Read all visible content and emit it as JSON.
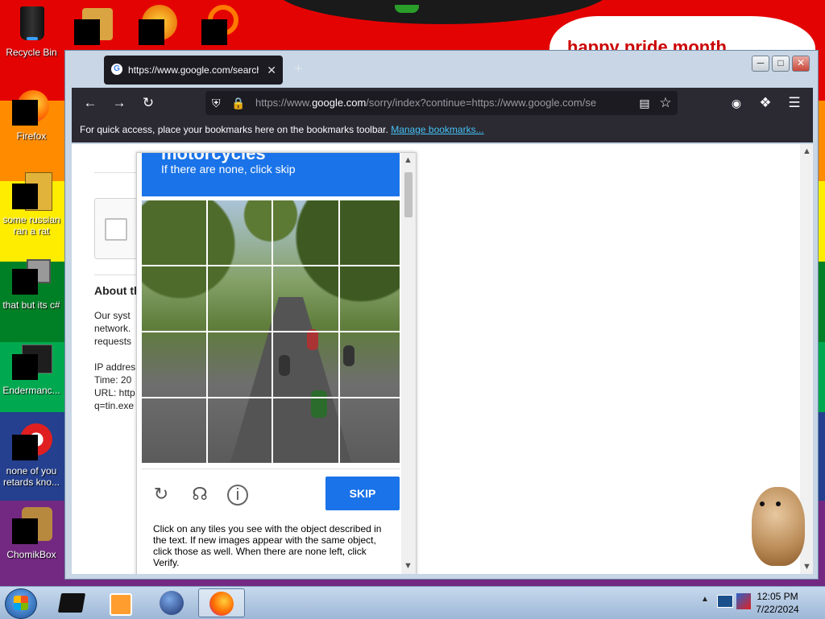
{
  "wallpaper": {
    "stripes": [
      "#e40303",
      "#ff8c00",
      "#ffed00",
      "#008026",
      "#24408e",
      "#732982"
    ],
    "banner_text": "happy pride month"
  },
  "desktop_icons": [
    {
      "label": "Recycle Bin",
      "icon": "recycle-bin-icon"
    },
    {
      "label": "Firefox",
      "icon": "firefox-icon"
    },
    {
      "label": "some russian ran a rat",
      "icon": "app-icon"
    },
    {
      "label": "that but its c#",
      "icon": "app-icon"
    },
    {
      "label": "Endermanc...",
      "icon": "app-icon"
    },
    {
      "label": "none of you retards kno...",
      "icon": "app-icon"
    },
    {
      "label": "ChomikBox",
      "icon": "hamster-icon"
    }
  ],
  "browser": {
    "tab_title": "https://www.google.com/search",
    "url_prefix": "https://www.",
    "url_host": "google.com",
    "url_rest": "/sorry/index?continue=https://www.google.com/se",
    "bookmarks_text": "For quick access, place your bookmarks here on the bookmarks toolbar.",
    "bookmarks_link": "Manage bookmarks..."
  },
  "page": {
    "about_heading": "About th",
    "body_lines": [
      "Our syst",
      "network.",
      "requests"
    ],
    "info_lines": [
      "IP addres",
      "Time: 20",
      "URL: http",
      "q=tin.exe"
    ]
  },
  "captcha": {
    "target_word": "motorcycles",
    "subtitle": "If there are none, click skip",
    "skip_label": "SKIP",
    "instructions": "Click on any tiles you see with the object described in the text. If new images appear with the same object, click those as well. When there are none left, click Verify.",
    "grid": {
      "rows": 4,
      "cols": 4
    }
  },
  "taskbar": {
    "time": "12:05 PM",
    "date": "7/22/2024"
  }
}
